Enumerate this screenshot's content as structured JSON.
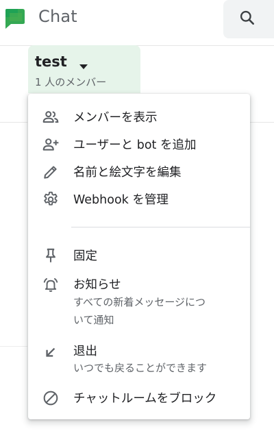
{
  "header": {
    "app_title": "Chat",
    "brand_color": "#34a853"
  },
  "room": {
    "name": "test",
    "members": "1 人のメンバー",
    "chip_color": "#e6f4ea"
  },
  "menu": {
    "items": [
      {
        "label": "メンバーを表示",
        "icon": "people-icon"
      },
      {
        "label": "ユーザーと bot を追加",
        "icon": "person-add-icon"
      },
      {
        "label": "名前と絵文字を編集",
        "icon": "pencil-icon"
      },
      {
        "label": "Webhook を管理",
        "icon": "gear-icon"
      },
      {
        "label": "固定",
        "icon": "pin-icon"
      },
      {
        "label": "お知らせ",
        "sub1": "すべての新着メッセージにつ",
        "sub2": "いて通知",
        "icon": "alarm-bell-icon"
      },
      {
        "label": "退出",
        "sub1": "いつでも戻ることができます",
        "icon": "arrow-down-left-icon"
      },
      {
        "label": "チャットルームをブロック",
        "icon": "block-icon"
      }
    ]
  }
}
